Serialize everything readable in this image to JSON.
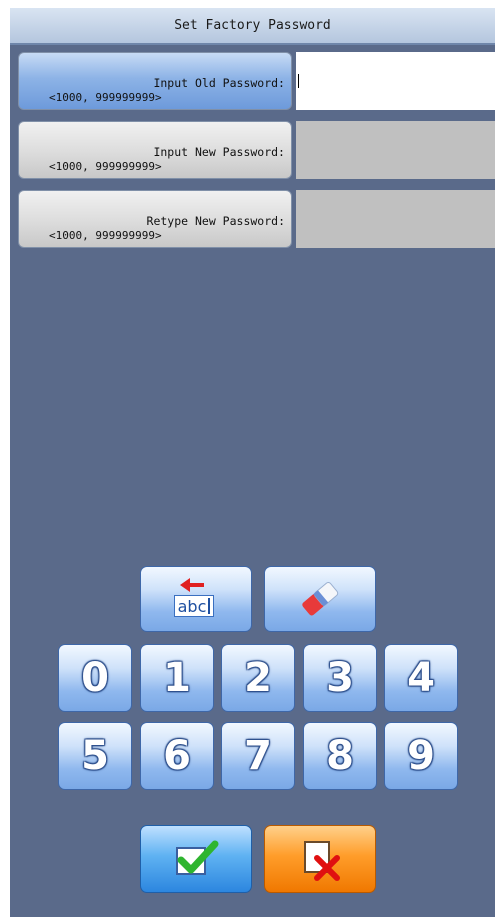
{
  "window": {
    "title": "Set Factory Password"
  },
  "fields": [
    {
      "label": "Input Old Password:",
      "range": "<1000, 999999999>",
      "value": ""
    },
    {
      "label": "Input New Password:",
      "range": "<1000, 999999999>",
      "value": ""
    },
    {
      "label": "Retype New Password:",
      "range": "<1000, 999999999>",
      "value": ""
    }
  ],
  "keypad": {
    "backspace_text": "abc",
    "digits": [
      "0",
      "1",
      "2",
      "3",
      "4",
      "5",
      "6",
      "7",
      "8",
      "9"
    ]
  },
  "icons": {
    "backspace": "backspace-icon",
    "clear": "eraser-icon",
    "ok": "checkmark-icon",
    "cancel": "cancel-icon"
  },
  "colors": {
    "background": "#5a6a8a",
    "active_field": "#ffffff",
    "disabled_field": "#c0c0c0",
    "ok_button": "#2c86df",
    "cancel_button": "#f07800"
  }
}
